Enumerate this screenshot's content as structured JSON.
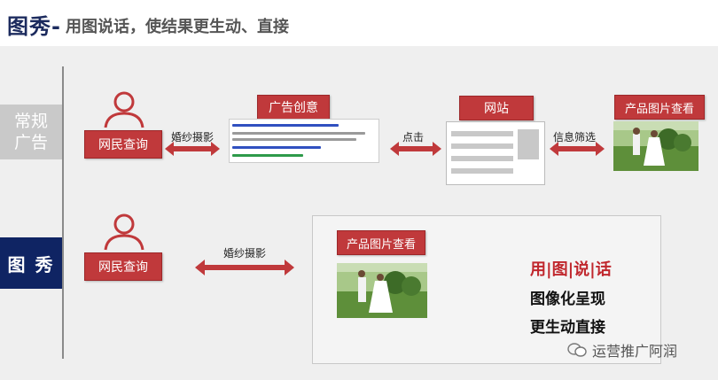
{
  "header": {
    "brand": "图秀-",
    "tagline": "用图说话，使结果更生动、直接"
  },
  "categories": {
    "regular": "常规\n广告",
    "tuxiu": "图 秀"
  },
  "regular_flow": {
    "user_label": "网民查询",
    "arrow1_label": "婚纱摄影",
    "ad_title": "广告创意",
    "arrow2_label": "点击",
    "site_title": "网站",
    "arrow3_label": "信息筛选",
    "photo_title": "产品图片查看"
  },
  "tuxiu_flow": {
    "user_label": "网民查询",
    "arrow_label": "婚纱摄影",
    "photo_title": "产品图片查看",
    "slogan1": "用|图|说|话",
    "slogan2": "图像化呈现",
    "slogan3": "更生动直接"
  },
  "watermark": "运营推广阿润",
  "colors": {
    "accent_red": "#c0393b",
    "navy": "#0f2463",
    "gray_block": "#c9c9c9"
  }
}
